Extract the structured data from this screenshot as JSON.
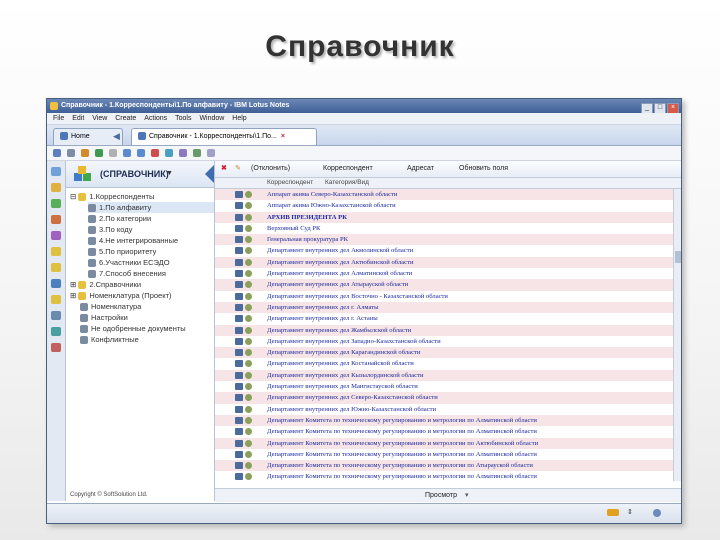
{
  "slide": {
    "title": "Справочник"
  },
  "window": {
    "title": "Справочник - 1.Корреспонденты\\1.По алфавиту - IBM Lotus Notes"
  },
  "menu": [
    "File",
    "Edit",
    "View",
    "Create",
    "Actions",
    "Tools",
    "Window",
    "Help"
  ],
  "tabs": [
    {
      "label": "Home"
    },
    {
      "label": "Справочник - 1.Корреспонденты\\1.По..."
    }
  ],
  "nav": {
    "header": "(СПРАВОЧНИК)",
    "tree": [
      {
        "label": "1.Корреспонденты"
      },
      {
        "label": "1.По алфавиту"
      },
      {
        "label": "2.По категории"
      },
      {
        "label": "3.По коду"
      },
      {
        "label": "4.Не интегрированные"
      },
      {
        "label": "5.По приоритету"
      },
      {
        "label": "6.Участники ЕСЭДО"
      },
      {
        "label": "7.Способ внесения"
      },
      {
        "label": "2.Справочники"
      },
      {
        "label": "Номенклатура (Проект)"
      },
      {
        "label": "Номенклатура"
      },
      {
        "label": "Настройки"
      },
      {
        "label": "Не одобренные документы"
      },
      {
        "label": "Конфликтные"
      }
    ],
    "footer": "Copyright © SoftSolution Ltd."
  },
  "view": {
    "actions": [
      "(Отклонить)",
      "Корреспондент",
      "Адресат",
      "Обновить поля"
    ],
    "columns": [
      "Корреспондент",
      "Категория/Вид"
    ],
    "rows": [
      "Аппарат акима Северо-Казахстанской области",
      "Аппарат акима Южно-Казахстанской области",
      "АРХИВ ПРЕЗИДЕНТА РК",
      "Верховный Суд РК",
      "Генеральная прокуратура РК",
      "Департамент внутренних дел Акмолинской области",
      "Департамент внутренних дел Актюбинской области",
      "Департамент внутренних дел Алматинской области",
      "Департамент внутренних дел Атырауской области",
      "Департамент внутренних дел Восточно - Казахстанской области",
      "Департамент внутренних дел г. Алматы",
      "Департамент внутренних дел г. Астаны",
      "Департамент внутренних дел Жамбылской области",
      "Департамент внутренних дел Западно-Казахстанской области",
      "Департамент внутренних дел Карагандинской области",
      "Департамент внутренних дел Костанайской области",
      "Департамент внутренних дел Кызылординской области",
      "Департамент внутренних дел Мангистауской области",
      "Департамент внутренних дел Северо-Казахстанской области",
      "Департамент внутренних дел Южно-Казахстанской области",
      "Департамент Комитета по техническому регулированию и метрологии по Алматинской области",
      "Департамент Комитета по техническому регулированию и метрологии по Алматинской области",
      "Департамент Комитета по техническому регулированию и метрологии по Актюбинской области",
      "Департамент Комитета по техническому регулированию и метрологии по Алматинской области",
      "Департамент Комитета по техническому регулированию и метрологии по Атырауской области",
      "Департамент Комитета по техническому регулированию и метрологии по Алматинской области"
    ],
    "footer": "Просмотр"
  },
  "colors": {
    "accent": "#3e5f96",
    "row_alt": "#f7e4e6",
    "link_text": "#1a2a9e"
  }
}
